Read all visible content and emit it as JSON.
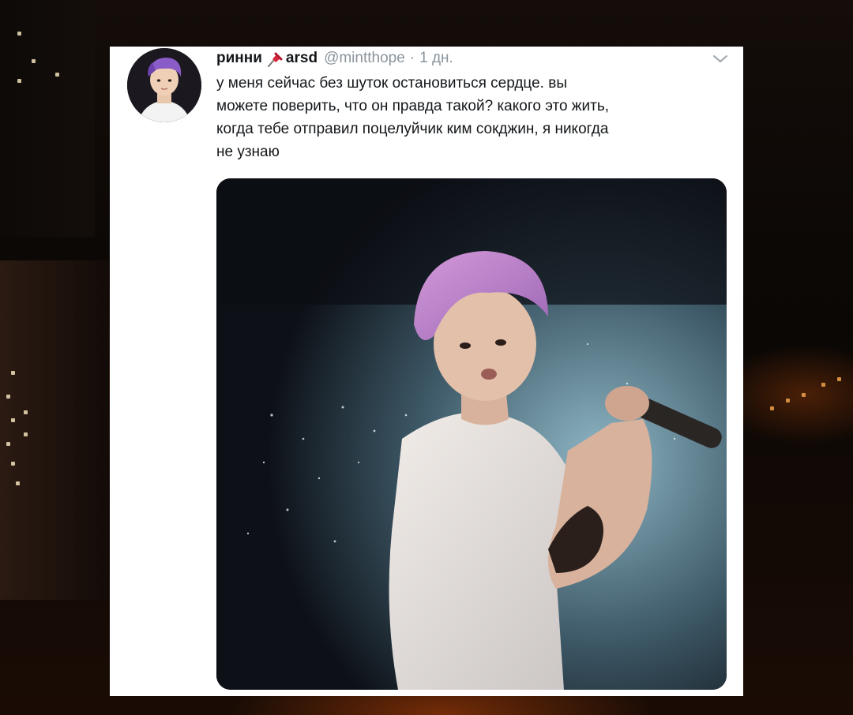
{
  "tweet": {
    "display_name": "ринни",
    "name_suffix": "arsd",
    "handle": "@mintthope",
    "separator": "·",
    "time": "1 дн.",
    "text_lines": [
      "у меня сейчас без шуток остановиться сердце. вы",
      "можете поверить, что он правда такой? какого это жить,",
      "когда тебе отправил поцелуйчик ким сокджин, я никогда",
      "не узнаю"
    ],
    "icons": {
      "pin": "pushpin-icon",
      "menu": "chevron-down-icon"
    }
  },
  "colors": {
    "card_background": "#ffffff",
    "text_primary": "#14171a",
    "text_secondary": "#8a949c",
    "pin_red": "#d7263d",
    "hair_purple": "#b67fc8"
  }
}
